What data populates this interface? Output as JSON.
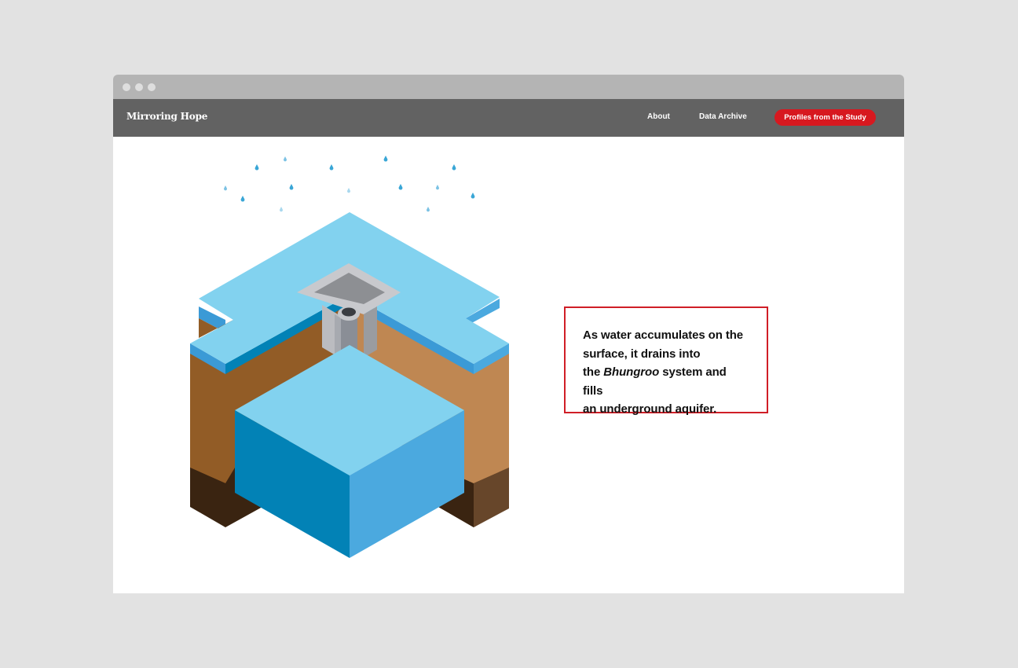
{
  "nav": {
    "brand": "Mirroring Hope",
    "links": [
      {
        "label": "About"
      },
      {
        "label": "Data Archive"
      }
    ],
    "cta_label": "Profiles from the Study"
  },
  "callout": {
    "line1": "As water accumulates on the",
    "line2": "surface, it drains into",
    "line3_prefix": "the ",
    "line3_emphasis": "Bhungroo",
    "line3_suffix": " system and fills",
    "line4": "an underground aquifer."
  },
  "colors": {
    "accent": "#d7181f",
    "navbar": "#626262",
    "titlebar": "#b4b4b4",
    "water_top": "#82d2ef",
    "water_left": "#0282b6",
    "water_right": "#4ba9df",
    "soil_left": "#925c26",
    "soil_right": "#bf8752"
  },
  "icons": {
    "window_controls": [
      "circle-icon",
      "circle-icon",
      "circle-icon"
    ],
    "raindrops": "raindrop-icon"
  }
}
